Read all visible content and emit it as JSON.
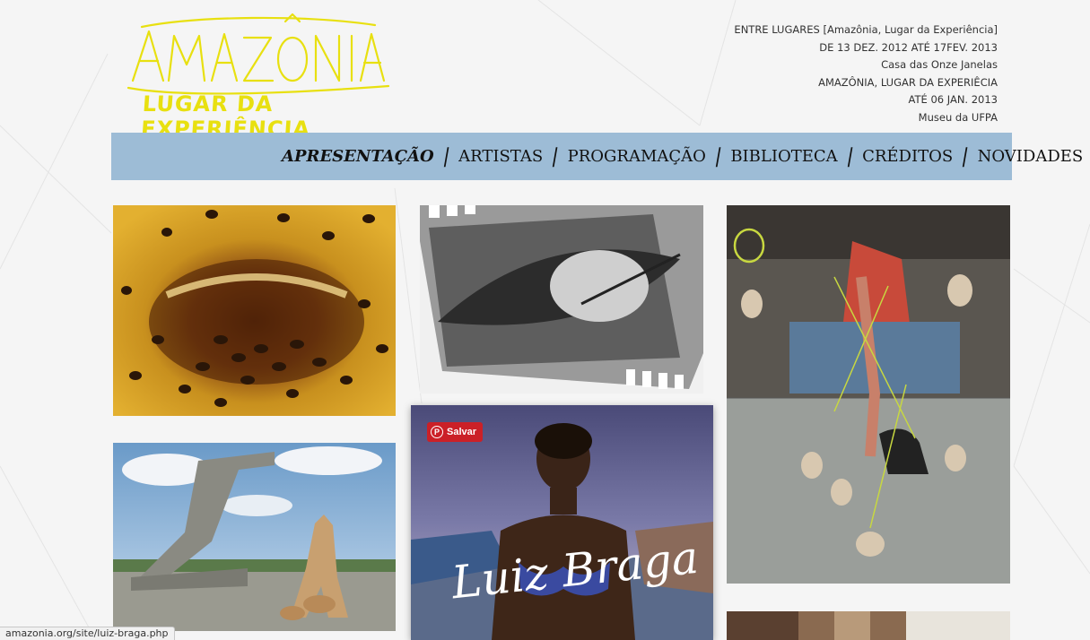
{
  "logo": {
    "line1": "AMAZÔNIA",
    "line2": "LUGAR DA EXPERIÊNCIA",
    "color": "#e8e010"
  },
  "info": {
    "lines": [
      "ENTRE LUGARES [Amazônia, Lugar da Experiência]",
      "DE 13 DEZ. 2012 ATÉ 17FEV. 2013",
      "Casa das Onze Janelas",
      "AMAZÔNIA, LUGAR DA EXPERIÊCIA",
      "ATÉ 06 JAN. 2013",
      "Museu da UFPA"
    ]
  },
  "nav": {
    "background": "#9dbcd6",
    "items": [
      {
        "label": "APRESENTAÇÃO"
      },
      {
        "label": "ARTISTAS"
      },
      {
        "label": "PROGRAMAÇÃO"
      },
      {
        "label": "BIBLIOTECA"
      },
      {
        "label": "CRÉDITOS"
      },
      {
        "label": "NOVIDADES"
      }
    ]
  },
  "tiles": {
    "braga_caption": "Luiz Braga"
  },
  "pin_button": {
    "label": "Salvar",
    "color": "#cb2027",
    "icon": "pinterest-icon"
  },
  "status_bar": {
    "url": "amazonia.org/site/luiz-braga.php"
  }
}
